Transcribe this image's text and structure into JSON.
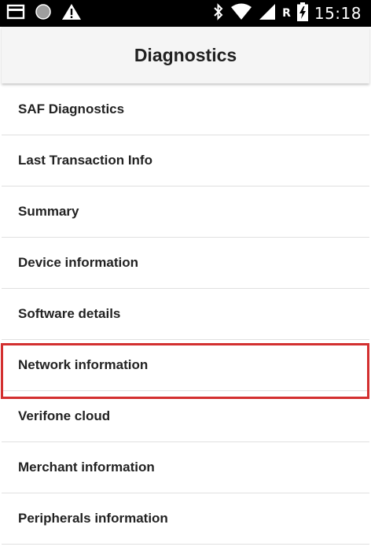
{
  "status_bar": {
    "time": "15:18",
    "roaming_indicator": "R",
    "left_icons": [
      "card-icon",
      "record-icon",
      "warning-icon"
    ],
    "right_icons": [
      "bluetooth-icon",
      "wifi-icon",
      "cell-signal-icon",
      "battery-charging-icon"
    ]
  },
  "header": {
    "title": "Diagnostics"
  },
  "menu": {
    "items": [
      {
        "label": "SAF Diagnostics"
      },
      {
        "label": "Last Transaction Info"
      },
      {
        "label": "Summary"
      },
      {
        "label": "Device information"
      },
      {
        "label": "Software details"
      },
      {
        "label": "Network information"
      },
      {
        "label": "Verifone cloud"
      },
      {
        "label": "Merchant information"
      },
      {
        "label": "Peripherals information"
      }
    ],
    "highlighted_index": 5
  },
  "colors": {
    "status_bar_bg": "#000000",
    "app_bar_bg": "#f5f5f5",
    "highlight_border": "#d32f2f",
    "text": "#222222"
  }
}
